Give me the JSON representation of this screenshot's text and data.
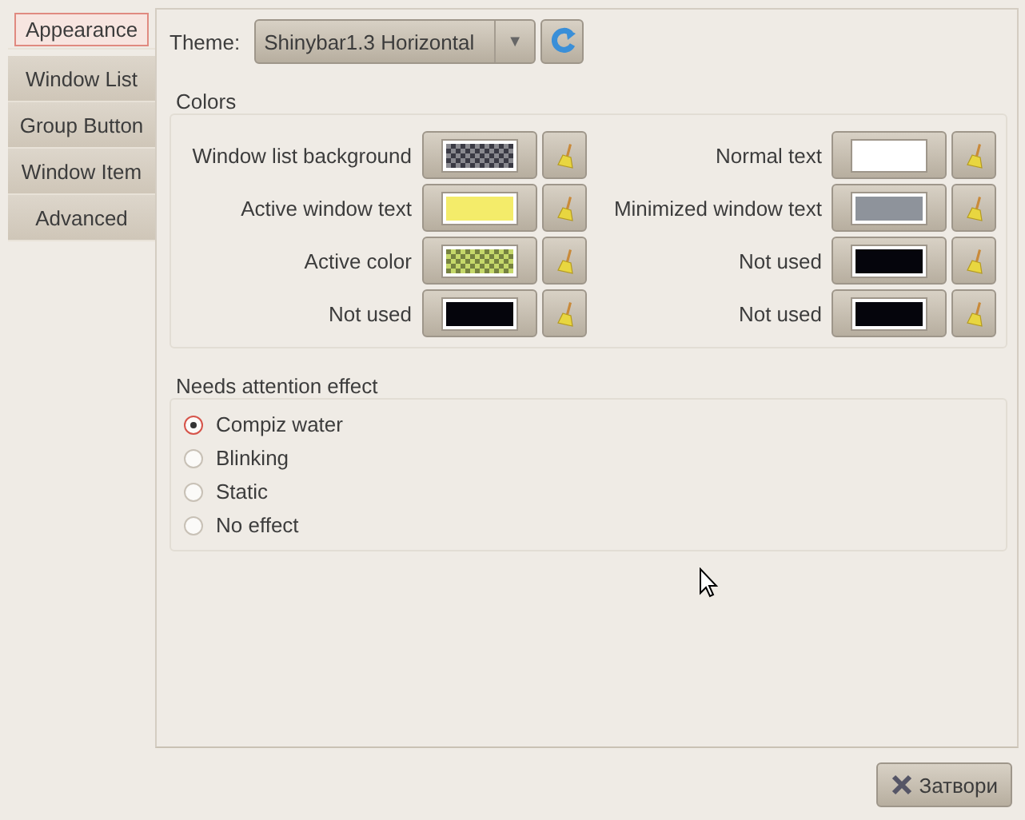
{
  "tabs": [
    {
      "label": "Appearance",
      "selected": true
    },
    {
      "label": "Window List",
      "selected": false
    },
    {
      "label": "Group Button",
      "selected": false
    },
    {
      "label": "Window Item",
      "selected": false
    },
    {
      "label": "Advanced",
      "selected": false
    }
  ],
  "theme": {
    "label": "Theme:",
    "value": "Shinybar1.3 Horizontal",
    "arrow": "▼"
  },
  "colors": {
    "title": "Colors",
    "items": [
      {
        "label": "Window list background",
        "color": "#3a3a44",
        "checkered": true
      },
      {
        "label": "Normal text",
        "color": "#ffffff",
        "checkered": false
      },
      {
        "label": "Active window text",
        "color": "#f4ec6a",
        "checkered": false
      },
      {
        "label": "Minimized window text",
        "color": "#8e939b",
        "checkered": false
      },
      {
        "label": "Active color",
        "color": "#c5d86a",
        "checkered": true
      },
      {
        "label": "Not used",
        "color": "#05050c",
        "checkered": false
      },
      {
        "label": "Not used",
        "color": "#05050c",
        "checkered": false
      },
      {
        "label": "Not used",
        "color": "#05050c",
        "checkered": false
      }
    ]
  },
  "attention": {
    "title": "Needs attention effect",
    "options": [
      {
        "label": "Compiz water",
        "selected": true
      },
      {
        "label": "Blinking",
        "selected": false
      },
      {
        "label": "Static",
        "selected": false
      },
      {
        "label": "No effect",
        "selected": false
      }
    ]
  },
  "close_button": {
    "label": "Затвори"
  }
}
